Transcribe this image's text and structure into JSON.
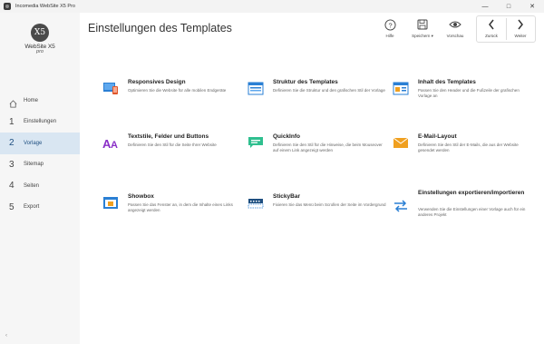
{
  "window": {
    "title": "Incomedia WebSite X5 Pro"
  },
  "logo": {
    "mark": "X5",
    "name": "WebSite X5",
    "edition": "pro"
  },
  "sidebar": {
    "items": [
      {
        "num": "",
        "label": "Home"
      },
      {
        "num": "1",
        "label": "Einstellungen"
      },
      {
        "num": "2",
        "label": "Vorlage"
      },
      {
        "num": "3",
        "label": "Sitemap"
      },
      {
        "num": "4",
        "label": "Seiten"
      },
      {
        "num": "5",
        "label": "Export"
      }
    ],
    "active_index": 2,
    "bottom_arrow": "‹"
  },
  "header": {
    "title": "Einstellungen des Templates",
    "toolbar": {
      "help": "Hilfe",
      "save": "Speichern ▾",
      "preview": "Vorschau",
      "back": "Zurück",
      "next": "Weiter"
    }
  },
  "cards": [
    {
      "title": "Responsives Design",
      "desc": "Optimieren Sie die Website für alle mobilen Endgeräte",
      "icon": "responsive-icon"
    },
    {
      "title": "Struktur des Templates",
      "desc": "Definieren Sie die Struktur und den grafischen Stil der Vorlage",
      "icon": "structure-icon"
    },
    {
      "title": "Inhalt des Templates",
      "desc": "Passen Sie den Header und die Fußzeile der grafischen Vorlage an",
      "icon": "content-icon"
    },
    {
      "title": "Textstile, Felder und Buttons",
      "desc": "Definieren Sie den Stil für die Seite Ihrer Website",
      "icon": "text-styles-icon"
    },
    {
      "title": "QuickInfo",
      "desc": "Definieren Sie den Stil für die Hinweise, die beim Mouseover auf einem Link angezeigt werden",
      "icon": "quickinfo-icon"
    },
    {
      "title": "E-Mail-Layout",
      "desc": "Definieren Sie den Stil der E-Mails, die aus der Website gesendet werden",
      "icon": "email-icon"
    },
    {
      "title": "Showbox",
      "desc": "Passen Sie das Fenster an, in dem die Inhalte eines Links angezeigt werden",
      "icon": "showbox-icon"
    },
    {
      "title": "StickyBar",
      "desc": "Fixieren Sie das Menü beim Scrollen der Seite im Vordergrund",
      "icon": "stickybar-icon"
    },
    {
      "title": "Einstellungen exportieren/importieren",
      "desc": "Verwenden Sie die Einstellungen einer Vorlage auch für ein anderes Projekt",
      "icon": "export-import-icon"
    }
  ],
  "colors": {
    "accent": "#2a7fd4",
    "active_nav": "#d9e6f2",
    "purple": "#8a2fc7",
    "teal": "#2fbf8f",
    "orange": "#f0a020"
  }
}
